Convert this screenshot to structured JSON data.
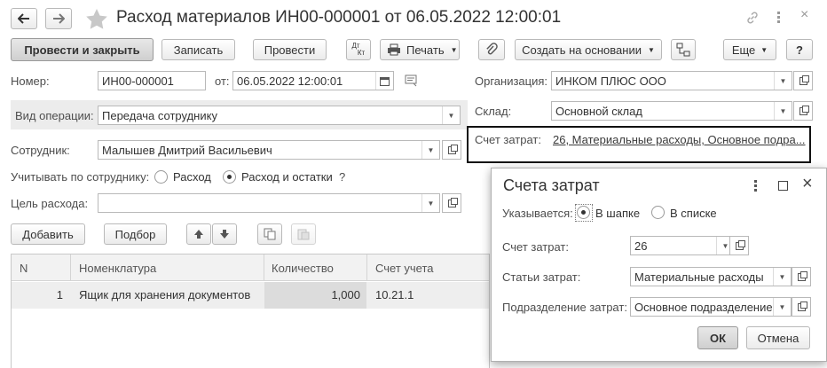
{
  "window": {
    "title": "Расход материалов ИН00-000001 от 06.05.2022 12:00:01"
  },
  "toolbar": {
    "post_close": "Провести и закрыть",
    "save": "Записать",
    "post": "Провести",
    "dtkt_top": "Дт",
    "dtkt_bottom": "Кт",
    "print": "Печать",
    "create_based": "Создать на основании",
    "more": "Еще",
    "help": "?"
  },
  "form": {
    "number_label": "Номер:",
    "number_value": "ИН00-000001",
    "from_label": "от:",
    "date_value": "06.05.2022 12:00:01",
    "optype_label": "Вид операции:",
    "optype_value": "Передача сотруднику",
    "employee_label": "Сотрудник:",
    "employee_value": "Малышев Дмитрий Васильевич",
    "account_by_label": "Учитывать по сотруднику:",
    "radio_expense": "Расход",
    "radio_expense_balance": "Расход и остатки",
    "question": "?",
    "purpose_label": "Цель расхода:",
    "purpose_value": "",
    "org_label": "Организация:",
    "org_value": "ИНКОМ ПЛЮС ООО",
    "warehouse_label": "Склад:",
    "warehouse_value": "Основной склад",
    "cost_account_label": "Счет затрат:",
    "cost_account_link": "26, Материальные расходы, Основное подра..."
  },
  "table_toolbar": {
    "add": "Добавить",
    "pick": "Подбор"
  },
  "table": {
    "columns": [
      "N",
      "Номенклатура",
      "Количество",
      "Счет учета"
    ],
    "rows": [
      {
        "n": "1",
        "item": "Ящик для хранения документов",
        "qty": "1,000",
        "account": "10.21.1"
      }
    ]
  },
  "dialog": {
    "title": "Счета затрат",
    "specified_label": "Указывается:",
    "opt_header": "В шапке",
    "opt_list": "В списке",
    "account_label": "Счет затрат:",
    "account_value": "26",
    "items_label": "Статьи затрат:",
    "items_value": "Материальные расходы",
    "division_label": "Подразделение затрат:",
    "division_value": "Основное подразделение",
    "ok": "ОК",
    "cancel": "Отмена"
  }
}
